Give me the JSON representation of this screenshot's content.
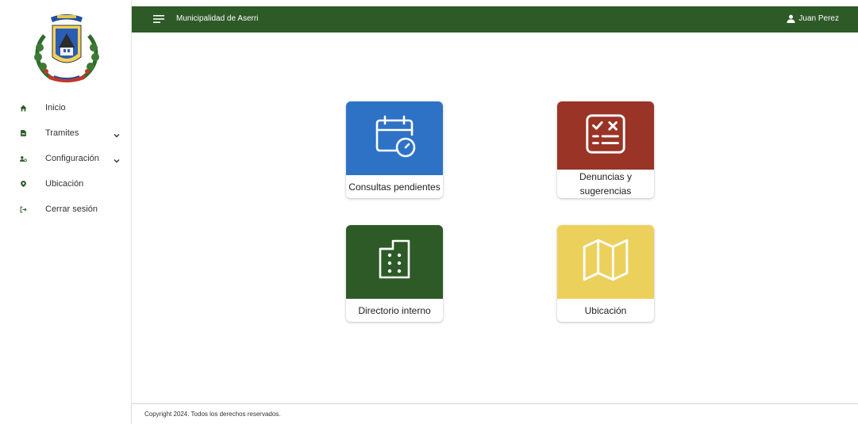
{
  "app": {
    "title": "Municipalidad de Aserri",
    "user_name": "Juan Perez"
  },
  "sidebar": {
    "items": [
      {
        "label": "Inicio",
        "icon": "home-icon"
      },
      {
        "label": "Tramites",
        "icon": "document-icon",
        "expandable": true
      },
      {
        "label": "Configuración",
        "icon": "users-cog-icon",
        "expandable": true
      },
      {
        "label": "Ubicación",
        "icon": "location-pin-icon"
      },
      {
        "label": "Cerrar sesión",
        "icon": "sign-out-icon"
      }
    ]
  },
  "cards": [
    {
      "label": "Consultas pendientes",
      "color": "#2e72c6",
      "icon": "calendar-clock-icon"
    },
    {
      "label": "Denuncias y sugerencias",
      "color": "#993427",
      "icon": "checklist-icon"
    },
    {
      "label": "Directorio interno",
      "color": "#2d5a27",
      "icon": "building-icon"
    },
    {
      "label": "Ubicación",
      "color": "#ecd05c",
      "icon": "map-icon"
    }
  ],
  "footer": {
    "copyright": "Copyright 2024. Todos los derechos reservados."
  },
  "colors": {
    "brand_green": "#2d5a27",
    "blue": "#2e72c6",
    "red": "#993427",
    "yellow": "#ecd05c"
  }
}
